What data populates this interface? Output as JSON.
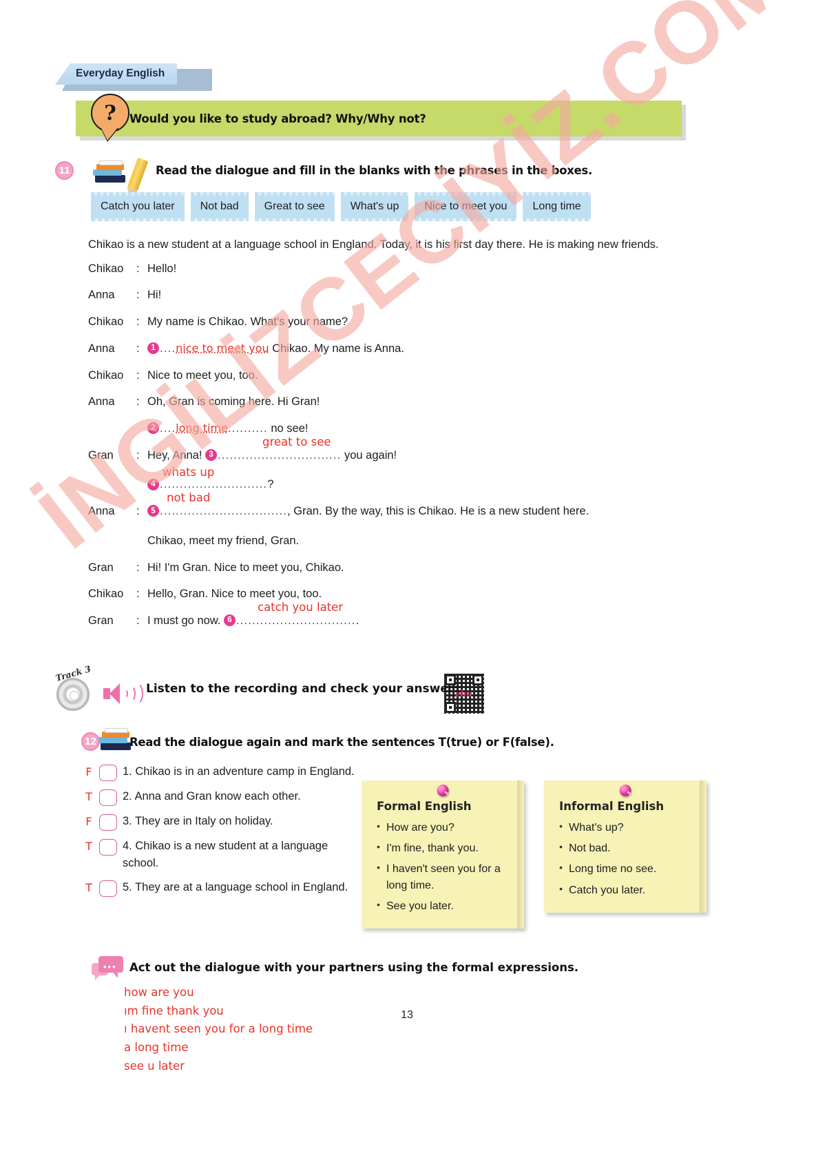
{
  "section": {
    "tab_label": "Everyday English"
  },
  "question_bar": {
    "icon": "question-mark-bubble",
    "text": "Would you like to study abroad? Why/Why not?"
  },
  "exercise11": {
    "number": "11",
    "instruction": "Read the dialogue and fill in the blanks with the phrases in the boxes.",
    "phrase_boxes": [
      "Catch you later",
      "Not bad",
      "Great to see",
      "What's up",
      "Nice to meet you",
      "Long time"
    ],
    "intro": "Chikao is a new student at a language school in England. Today, it is his first day there. He is making new friends.",
    "lines": [
      {
        "speaker": "Chikao",
        "colon": ":",
        "text": "Hello!"
      },
      {
        "speaker": "Anna",
        "colon": ":",
        "text": "Hi!"
      },
      {
        "speaker": "Chikao",
        "colon": ":",
        "text": "My name is Chikao. What's your name?"
      },
      {
        "speaker": "Anna",
        "colon": ":",
        "blank_num": "1",
        "answer": "nice to meet you",
        "text": " Chikao. My name is Anna."
      },
      {
        "speaker": "Chikao",
        "colon": ":",
        "text": "Nice to meet you, too."
      },
      {
        "speaker": "Anna",
        "colon": ":",
        "text": "Oh, Gran is coming here. Hi Gran!"
      }
    ],
    "blank2": {
      "num": "2",
      "answer": "long time",
      "dots_before": "....",
      "dots_after": "..........",
      "tail": " no see!"
    },
    "line_gran1": {
      "speaker": "Gran",
      "colon": ":",
      "pre": "Hey, Anna! ",
      "num": "3",
      "answer": "great to see",
      "dots": "...............................",
      "tail": " you again!"
    },
    "blank4": {
      "num": "4",
      "answer": "whats up",
      "dots": "...........................",
      "tail": "?"
    },
    "line_anna5": {
      "speaker": "Anna",
      "colon": ":",
      "num": "5",
      "answer": "not bad",
      "dots": "................................",
      "tail": ", Gran. By the way, this is Chikao. He is a new student here."
    },
    "line_anna5b": "Chikao, meet my friend, Gran.",
    "line_gran2": {
      "speaker": "Gran",
      "colon": ":",
      "text": "Hi! I'm Gran. Nice to meet you, Chikao."
    },
    "line_chikao2": {
      "speaker": "Chikao",
      "colon": ":",
      "text": "Hello, Gran. Nice to meet you, too."
    },
    "line_gran3": {
      "speaker": "Gran",
      "colon": ":",
      "pre": "I must go now. ",
      "num": "6",
      "answer": "catch you later",
      "dots": "..............................",
      "tail": "."
    }
  },
  "listening": {
    "track_label": "Track 3",
    "instruction": "Listen to the recording and check your answers.",
    "qr_caption": "ebu"
  },
  "exercise12": {
    "number": "12",
    "instruction": "Read the dialogue again and mark the sentences T(true) or F(false).",
    "items": [
      {
        "mark": "F",
        "num": "1.",
        "text": "Chikao is in an adventure camp in England."
      },
      {
        "mark": "T",
        "num": "2.",
        "text": "Anna and Gran know each other."
      },
      {
        "mark": "F",
        "num": "3.",
        "text": "They are in Italy on holiday."
      },
      {
        "mark": "T",
        "num": "4.",
        "text": "Chikao is a new student at a language school."
      },
      {
        "mark": "T",
        "num": "5.",
        "text": "They are at a language school in England."
      }
    ]
  },
  "notes": [
    {
      "title": "Formal English",
      "items": [
        "How are you?",
        "I'm fine, thank you.",
        "I haven't seen you for a long time.",
        "See you later."
      ]
    },
    {
      "title": "Informal English",
      "items": [
        "What's up?",
        "Not bad.",
        "Long time no see.",
        "Catch you later."
      ]
    }
  ],
  "actout": {
    "instruction": "Act out the dialogue with your partners using the formal expressions.",
    "handwritten": [
      "how are you",
      "ım fine thank you",
      "ı havent seen you for a long time",
      "a long time",
      "see u later"
    ]
  },
  "page_number": "13",
  "watermark": "İNGİLİZCECİYİZ.COM",
  "colors": {
    "tab_blue": "#b7d6ef",
    "bar_green": "#c6da6a",
    "phrase_blue": "#bfe0f2",
    "pink": "#e73a8d",
    "handwriting_red": "#e8332a",
    "note_yellow": "#f7f3b6",
    "watermark_pink": "#f5a9a0"
  }
}
